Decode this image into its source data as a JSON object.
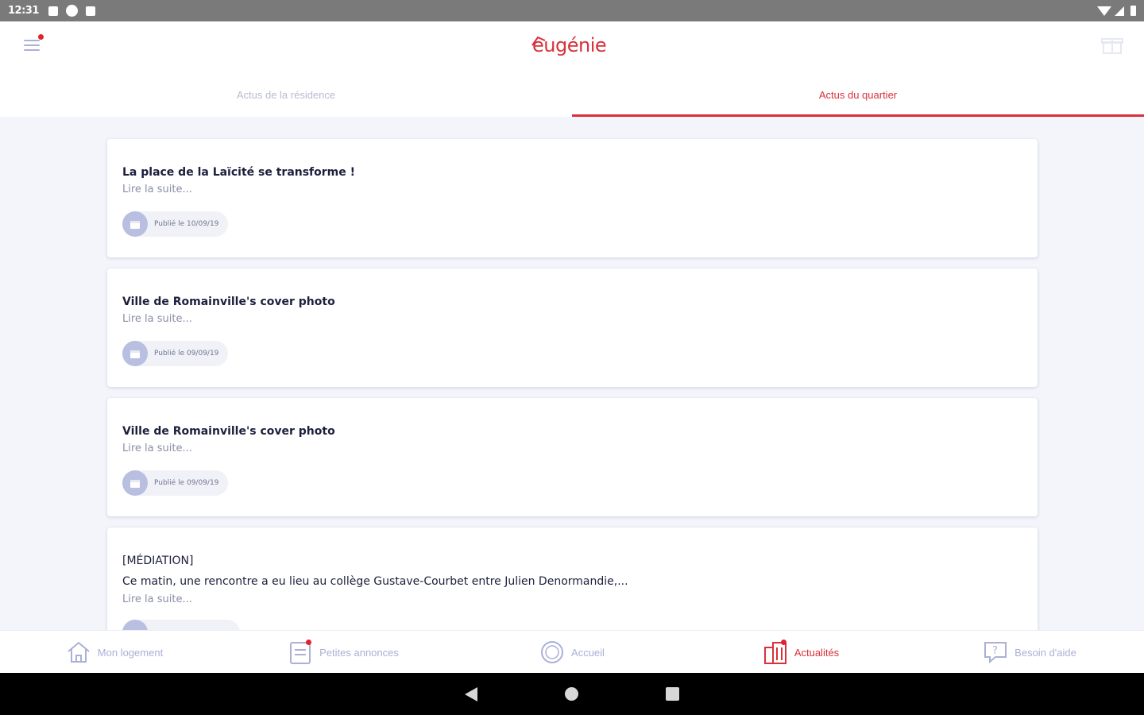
{
  "status_bar": {
    "time": "12:31"
  },
  "header": {
    "logo_text": "eugénie"
  },
  "tabs": [
    {
      "label": "Actus de la résidence",
      "active": false
    },
    {
      "label": "Actus du quartier",
      "active": true
    }
  ],
  "cards": [
    {
      "title": "La place de la Laïcité se transforme !",
      "body": "",
      "read_more": "Lire la suite...",
      "published": "Publié le 10/09/19"
    },
    {
      "title": "Ville de Romainville's cover photo",
      "body": "",
      "read_more": "Lire la suite...",
      "published": "Publié le 09/09/19"
    },
    {
      "title": "Ville de Romainville's cover photo",
      "body": "",
      "read_more": "Lire la suite...",
      "published": "Publié le 09/09/19"
    },
    {
      "title": "[MÉDIATION]",
      "body": "Ce matin, une rencontre a eu lieu au collège Gustave-Courbet entre Julien Denormandie,...",
      "read_more": "Lire la suite...",
      "published": ""
    }
  ],
  "bottom_nav": [
    {
      "label": "Mon logement",
      "icon": "home-icon",
      "active": false,
      "badge": false
    },
    {
      "label": "Petites annonces",
      "icon": "notes-icon",
      "active": false,
      "badge": true
    },
    {
      "label": "Accueil",
      "icon": "circle-icon",
      "active": false,
      "badge": false
    },
    {
      "label": "Actualités",
      "icon": "buildings-icon",
      "active": true,
      "badge": true
    },
    {
      "label": "Besoin d'aide",
      "icon": "help-chat-icon",
      "active": false,
      "badge": false
    }
  ],
  "colors": {
    "accent": "#d9303a",
    "muted": "#aab0d6",
    "background": "#f3f5fb"
  }
}
